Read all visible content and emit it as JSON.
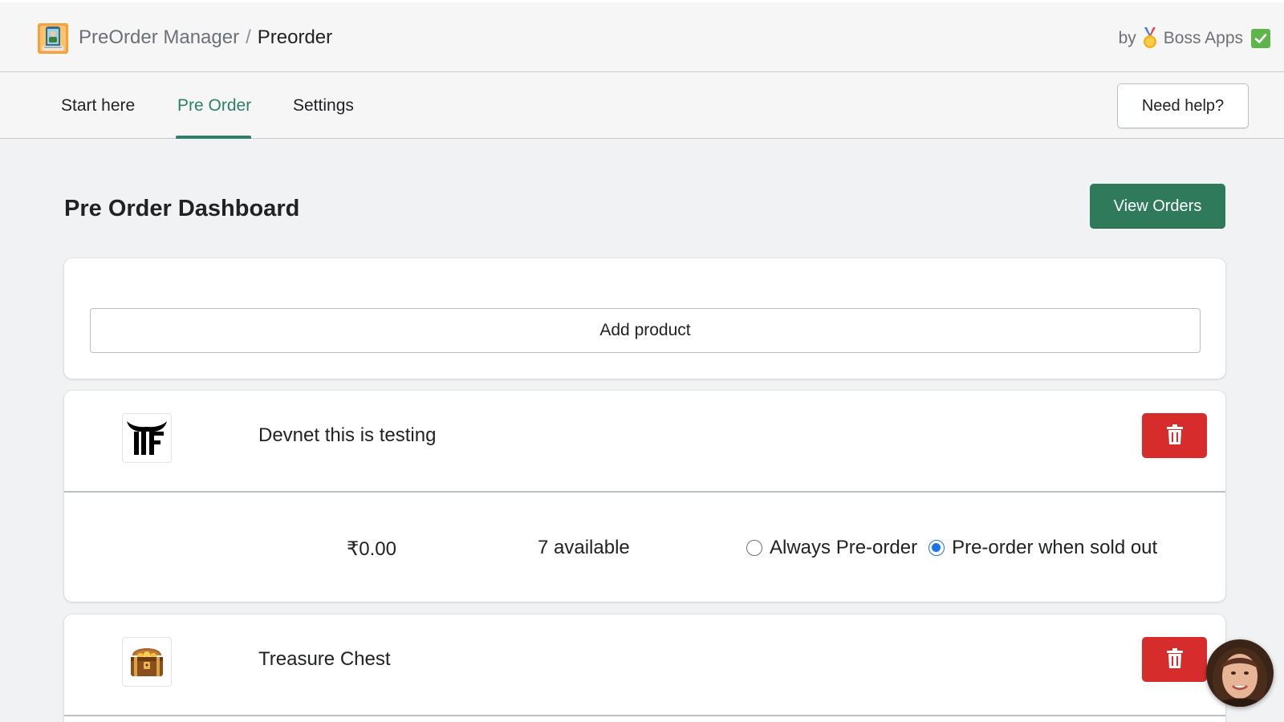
{
  "header": {
    "app_name": "PreOrder Manager",
    "separator": "/",
    "current_page": "Preorder",
    "byline_prefix": "by",
    "byline_brand": "Boss Apps",
    "icons": [
      "preorder-manager-logo",
      "medal-icon",
      "checkmark-icon"
    ]
  },
  "tabs": [
    {
      "label": "Start here",
      "active": false
    },
    {
      "label": "Pre Order",
      "active": true
    },
    {
      "label": "Settings",
      "active": false
    }
  ],
  "help_button": "Need help?",
  "page": {
    "title": "Pre Order Dashboard",
    "view_orders_label": "View Orders"
  },
  "add_product_label": "Add product",
  "products": [
    {
      "name": "Devnet this is testing",
      "thumbnail_icon": "tf-logo",
      "price": "₹0.00",
      "stock": "7 available",
      "options": [
        {
          "label": "Always Pre-order",
          "selected": false
        },
        {
          "label": "Pre-order when sold out",
          "selected": true
        }
      ]
    },
    {
      "name": "Treasure Chest",
      "thumbnail_icon": "treasure-chest-icon"
    }
  ],
  "colors": {
    "accent": "#2e8069",
    "primary_button": "#2e7a5b",
    "danger_button": "#d72c2c",
    "radio_selected": "#1a73e8",
    "background": "#f1f2f3"
  }
}
